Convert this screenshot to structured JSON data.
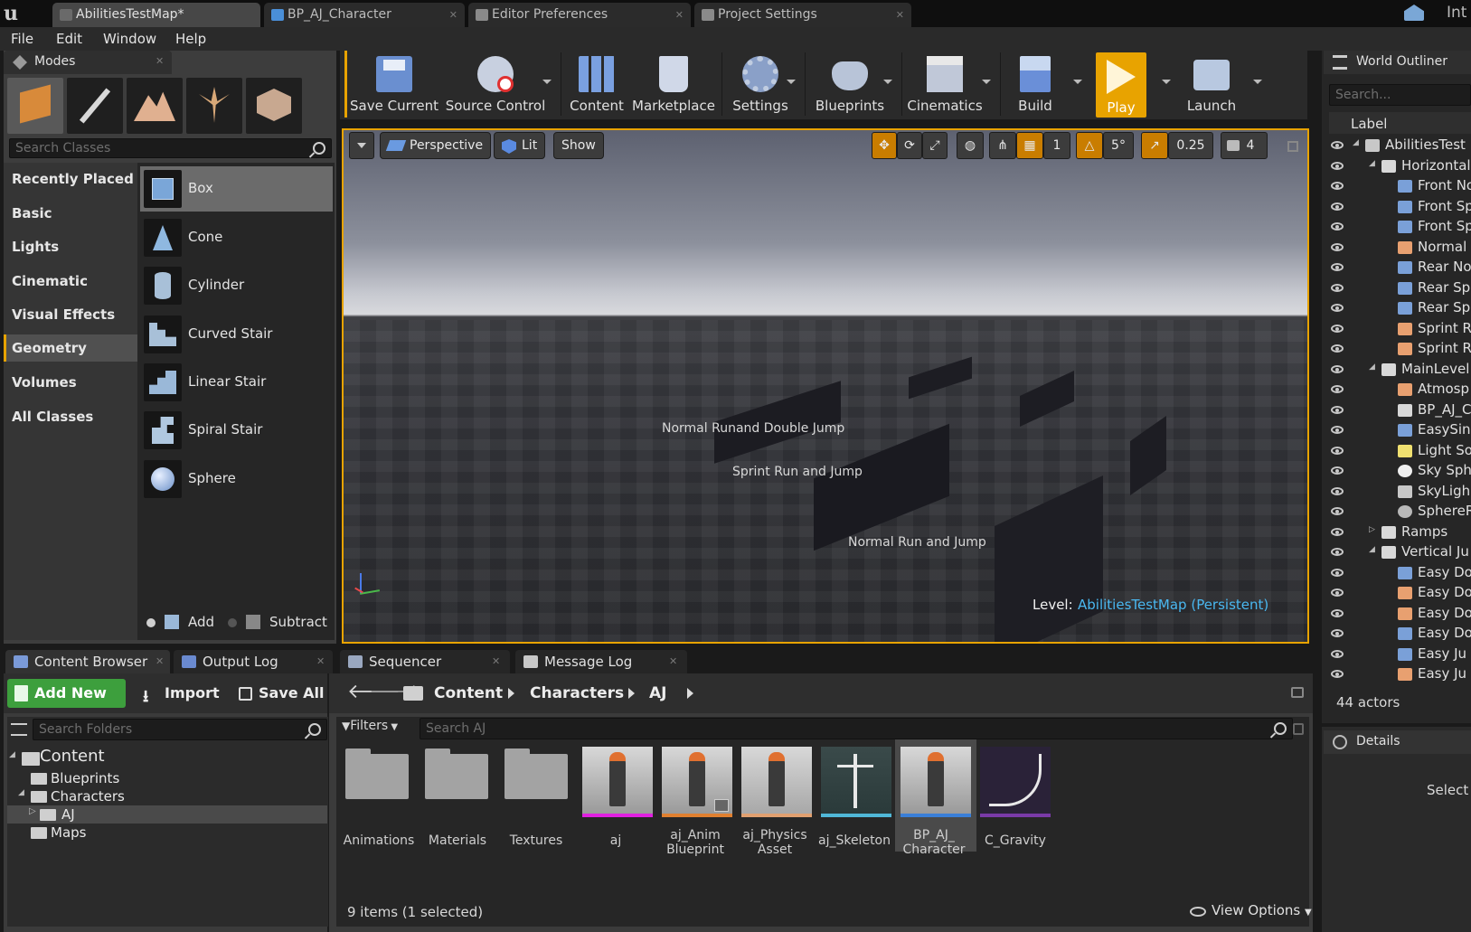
{
  "window": {
    "tabs": [
      "AbilitiesTestMap*",
      "BP_AJ_Character",
      "Editor Preferences",
      "Project Settings"
    ],
    "right_text": "Int"
  },
  "menu": [
    "File",
    "Edit",
    "Window",
    "Help"
  ],
  "modes": {
    "title": "Modes",
    "search_placeholder": "Search Classes",
    "categories": [
      "Recently Placed",
      "Basic",
      "Lights",
      "Cinematic",
      "Visual Effects",
      "Geometry",
      "Volumes",
      "All Classes"
    ],
    "selected_category": "Geometry",
    "items": [
      "Box",
      "Cone",
      "Cylinder",
      "Curved Stair",
      "Linear Stair",
      "Spiral Stair",
      "Sphere"
    ],
    "selected_item": "Box",
    "add_label": "Add",
    "subtract_label": "Subtract"
  },
  "toolbar": {
    "buttons": [
      "Save Current",
      "Source Control",
      "Content",
      "Marketplace",
      "Settings",
      "Blueprints",
      "Cinematics",
      "Build",
      "Play",
      "Launch"
    ],
    "accent": "#e8a300"
  },
  "viewport": {
    "view_mode": "Perspective",
    "lighting": "Lit",
    "show": "Show",
    "grid_snap": "1",
    "rotation_snap": "5°",
    "scale_snap": "0.25",
    "camera_speed": "4",
    "level_label": "Level:",
    "level_name": "AbilitiesTestMap (Persistent)",
    "level_color": "#4ab8f0",
    "sign_texts": [
      "Normal Runand Double Jump",
      "Sprint Run and Jump",
      "Normal Run and Jump"
    ]
  },
  "bottom_tabs": [
    "Content Browser",
    "Output Log",
    "Sequencer",
    "Message Log"
  ],
  "content_browser": {
    "add_new": "Add New",
    "import": "Import",
    "save_all": "Save All",
    "breadcrumb": [
      "Content",
      "Characters",
      "AJ"
    ],
    "folder_search_placeholder": "Search Folders",
    "filters": "Filters",
    "asset_search_placeholder": "Search AJ",
    "tree": [
      "Content",
      "Blueprints",
      "Characters",
      "AJ",
      "Maps"
    ],
    "assets": [
      {
        "name": "Animations",
        "type": "folder"
      },
      {
        "name": "Materials",
        "type": "folder"
      },
      {
        "name": "Textures",
        "type": "folder"
      },
      {
        "name": "aj",
        "type": "mesh",
        "color": "#e020e0"
      },
      {
        "name": "aj_Anim Blueprint",
        "type": "anim",
        "color": "#e08030"
      },
      {
        "name": "aj_Physics Asset",
        "type": "physics",
        "color": "#e0a070"
      },
      {
        "name": "aj_Skeleton",
        "type": "skeleton",
        "color": "#50b8d8"
      },
      {
        "name": "BP_AJ_ Character",
        "type": "blueprint",
        "color": "#3a7fd8"
      },
      {
        "name": "C_Gravity",
        "type": "curve",
        "color": "#7a3aa8"
      }
    ],
    "status": "9 items (1 selected)",
    "view_options": "View Options"
  },
  "outliner": {
    "title": "World Outliner",
    "search_placeholder": "Search...",
    "column": "Label",
    "rows": [
      {
        "label": "AbilitiesTest",
        "indent": 0,
        "icon": "world"
      },
      {
        "label": "Horizontal",
        "indent": 1,
        "icon": "folder"
      },
      {
        "label": "Front No",
        "indent": 2,
        "icon": "actor"
      },
      {
        "label": "Front Sp",
        "indent": 2,
        "icon": "actor"
      },
      {
        "label": "Front Sp",
        "indent": 2,
        "icon": "actor"
      },
      {
        "label": "Normal",
        "indent": 2,
        "icon": "text"
      },
      {
        "label": "Rear No",
        "indent": 2,
        "icon": "actor"
      },
      {
        "label": "Rear Sp",
        "indent": 2,
        "icon": "actor"
      },
      {
        "label": "Rear Sp",
        "indent": 2,
        "icon": "actor"
      },
      {
        "label": "Sprint R",
        "indent": 2,
        "icon": "text"
      },
      {
        "label": "Sprint R",
        "indent": 2,
        "icon": "text"
      },
      {
        "label": "MainLevel",
        "indent": 1,
        "icon": "folder"
      },
      {
        "label": "Atmosp",
        "indent": 2,
        "icon": "fog"
      },
      {
        "label": "BP_AJ_C",
        "indent": 2,
        "icon": "pawn"
      },
      {
        "label": "EasySin",
        "indent": 2,
        "icon": "actor"
      },
      {
        "label": "Light So",
        "indent": 2,
        "icon": "light"
      },
      {
        "label": "Sky Sph",
        "indent": 2,
        "icon": "sphere"
      },
      {
        "label": "SkyLigh",
        "indent": 2,
        "icon": "skylight"
      },
      {
        "label": "SphereR",
        "indent": 2,
        "icon": "reflect"
      },
      {
        "label": "Ramps",
        "indent": 1,
        "icon": "folder"
      },
      {
        "label": "Vertical Ju",
        "indent": 1,
        "icon": "folder"
      },
      {
        "label": "Easy Do",
        "indent": 2,
        "icon": "actor"
      },
      {
        "label": "Easy Do",
        "indent": 2,
        "icon": "text"
      },
      {
        "label": "Easy Do",
        "indent": 2,
        "icon": "text"
      },
      {
        "label": "Easy Do",
        "indent": 2,
        "icon": "actor"
      },
      {
        "label": "Easy Ju",
        "indent": 2,
        "icon": "actor"
      },
      {
        "label": "Easy Ju",
        "indent": 2,
        "icon": "text"
      }
    ],
    "actor_count": "44 actors"
  },
  "details": {
    "title": "Details",
    "hint": "Select"
  }
}
